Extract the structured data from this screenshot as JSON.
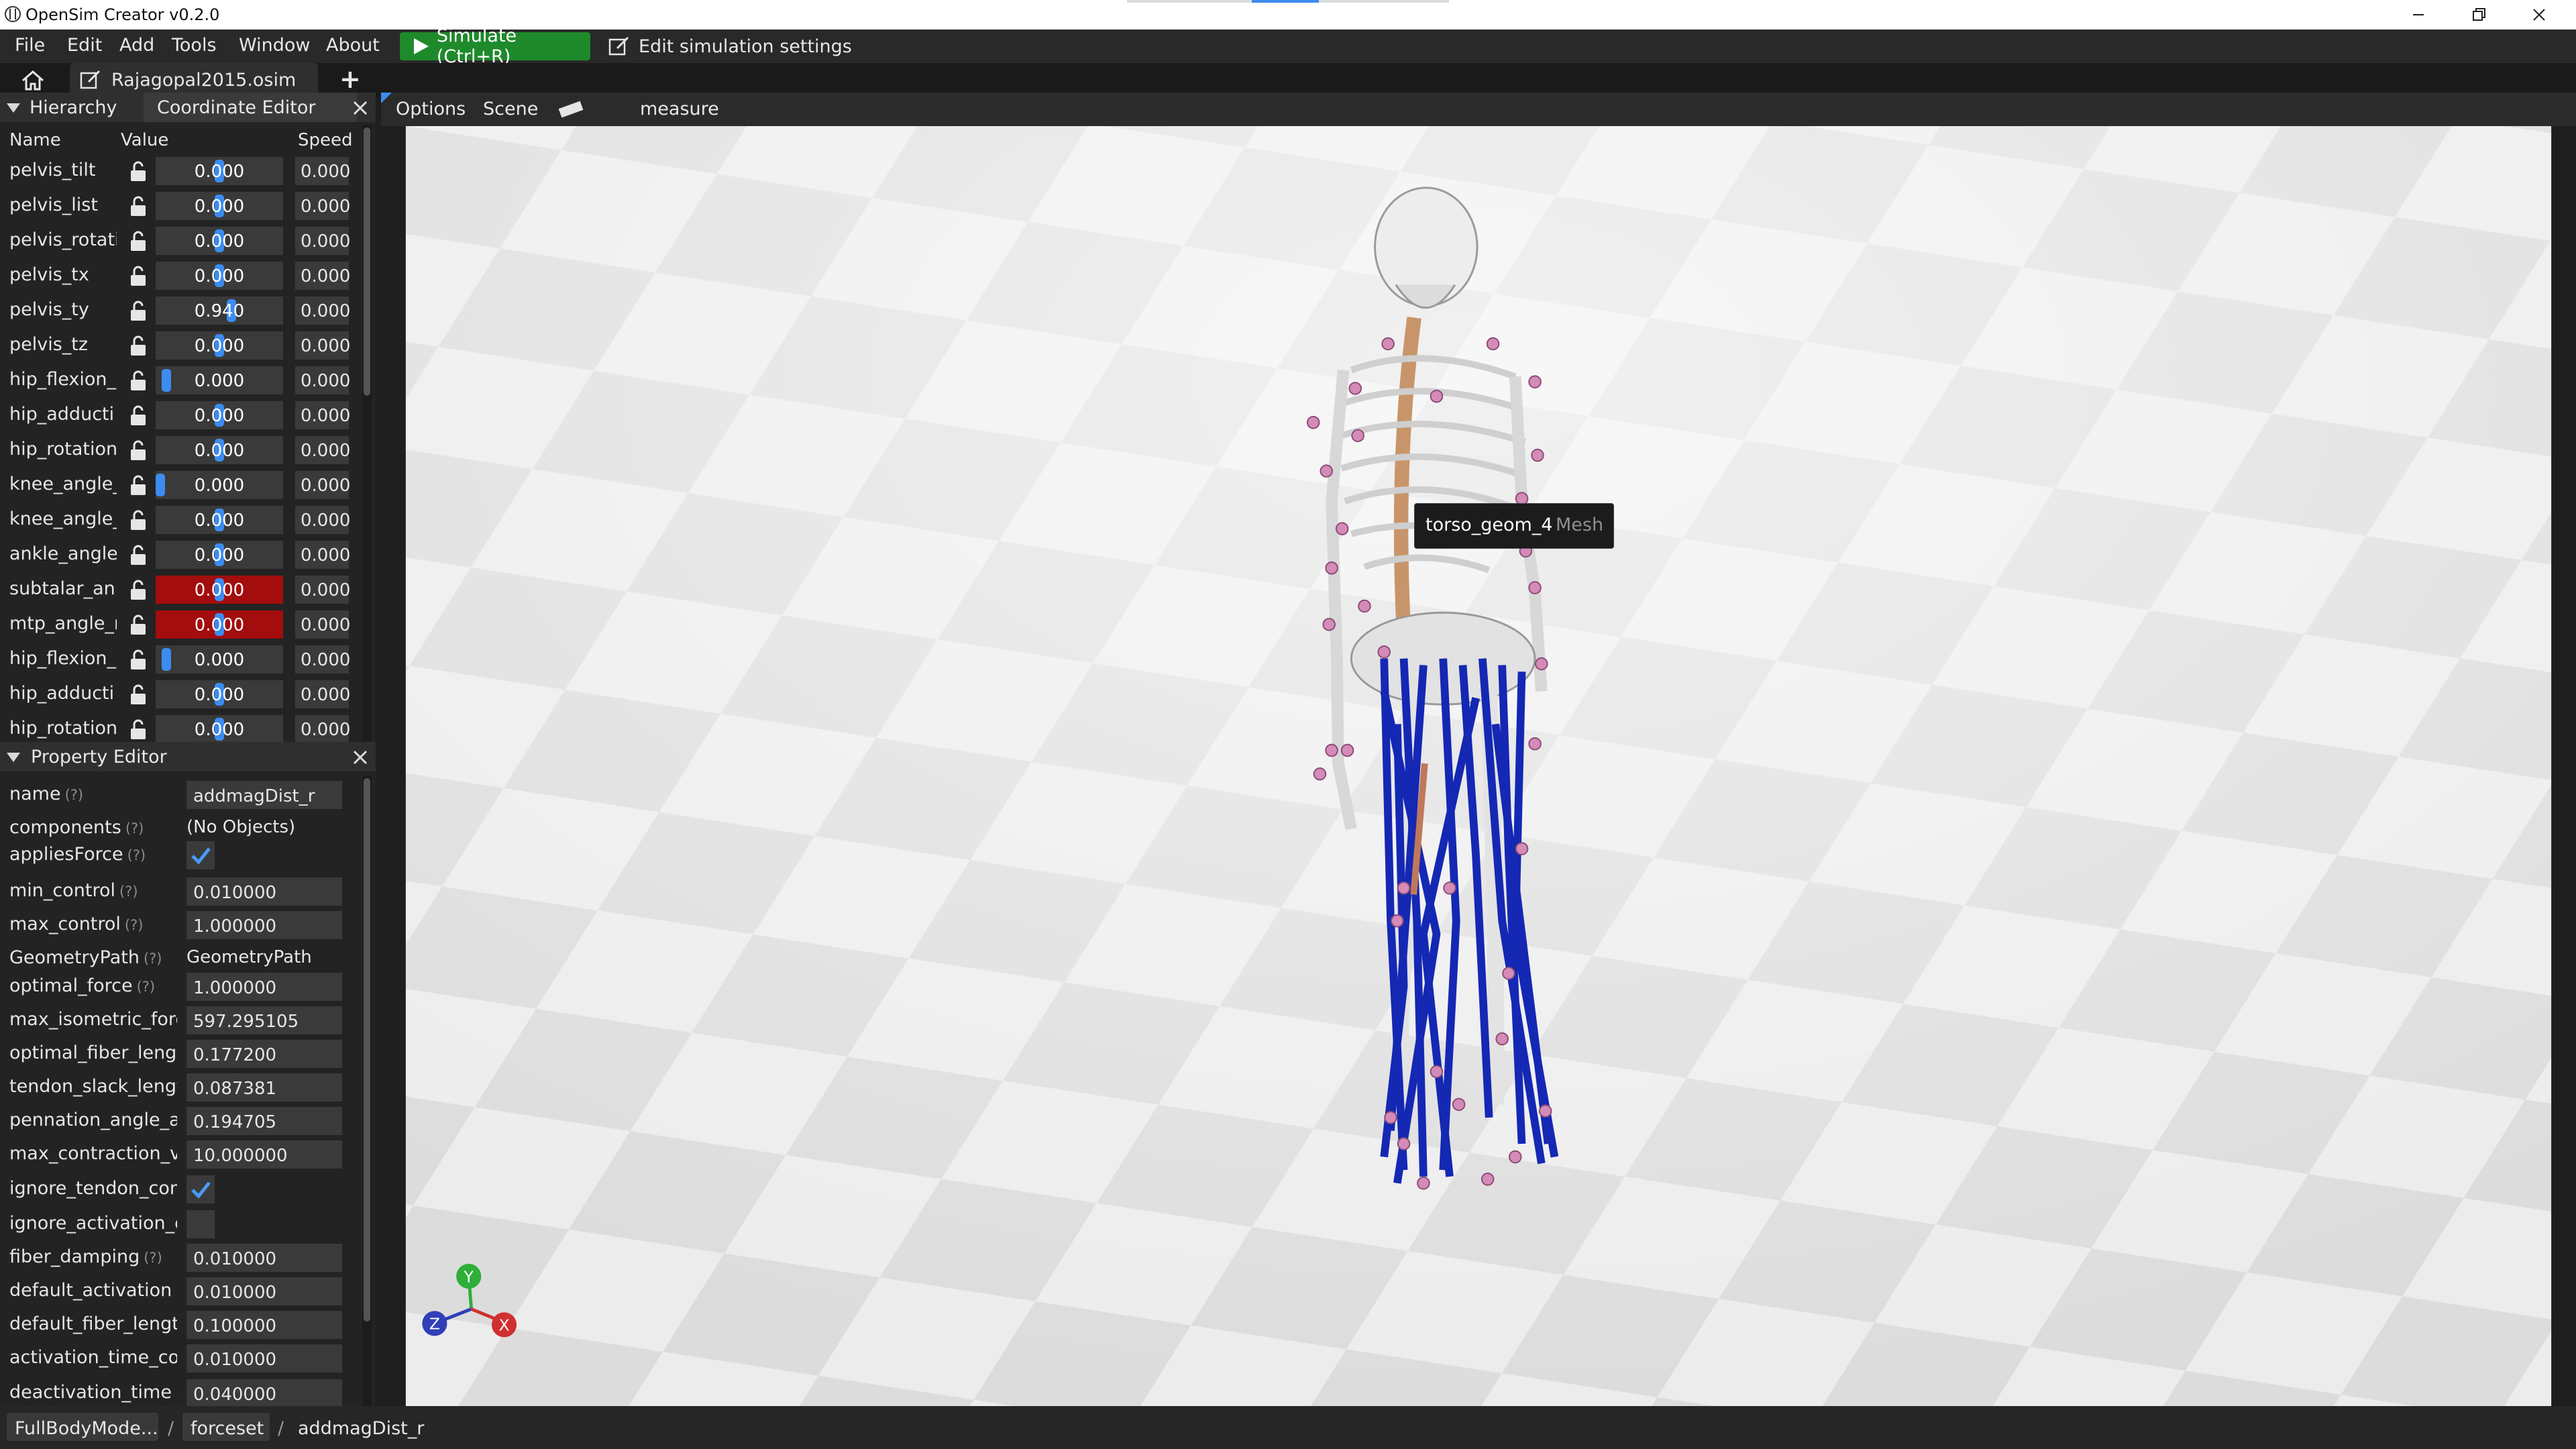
{
  "window": {
    "title": "OpenSim Creator v0.2.0"
  },
  "menu": {
    "items": [
      "File",
      "Edit",
      "Add",
      "Tools",
      "Window",
      "About"
    ],
    "simulate_label": "Simulate (Ctrl+R)",
    "edit_sim_label": "Edit simulation settings"
  },
  "tabs": {
    "file_tab": "Rajagopal2015.osim",
    "add_tab_glyph": "+"
  },
  "coordinate_panel": {
    "tab_hierarchy": "Hierarchy",
    "tab_coordinate_editor": "Coordinate Editor",
    "columns": {
      "name": "Name",
      "value": "Value",
      "speed": "Speed"
    },
    "rows": [
      {
        "name": "pelvis_tilt",
        "value": "0.000",
        "speed": "0.000",
        "locked": false,
        "slider_fraction": 0.5
      },
      {
        "name": "pelvis_list",
        "value": "0.000",
        "speed": "0.000",
        "locked": false,
        "slider_fraction": 0.5
      },
      {
        "name": "pelvis_rotati",
        "value": "0.000",
        "speed": "0.000",
        "locked": false,
        "slider_fraction": 0.5
      },
      {
        "name": "pelvis_tx",
        "value": "0.000",
        "speed": "0.000",
        "locked": false,
        "slider_fraction": 0.5
      },
      {
        "name": "pelvis_ty",
        "value": "0.940",
        "speed": "0.000",
        "locked": false,
        "slider_fraction": 0.6
      },
      {
        "name": "pelvis_tz",
        "value": "0.000",
        "speed": "0.000",
        "locked": false,
        "slider_fraction": 0.5
      },
      {
        "name": "hip_flexion_",
        "value": "0.000",
        "speed": "0.000",
        "locked": false,
        "slider_fraction": 0.05
      },
      {
        "name": "hip_adducti",
        "value": "0.000",
        "speed": "0.000",
        "locked": false,
        "slider_fraction": 0.5
      },
      {
        "name": "hip_rotation",
        "value": "0.000",
        "speed": "0.000",
        "locked": false,
        "slider_fraction": 0.5
      },
      {
        "name": "knee_angle_",
        "value": "0.000",
        "speed": "0.000",
        "locked": false,
        "slider_fraction": 0.0
      },
      {
        "name": "knee_angle_",
        "value": "0.000",
        "speed": "0.000",
        "locked": false,
        "slider_fraction": 0.5
      },
      {
        "name": "ankle_angle",
        "value": "0.000",
        "speed": "0.000",
        "locked": false,
        "slider_fraction": 0.5
      },
      {
        "name": "subtalar_an",
        "value": "0.000",
        "speed": "0.000",
        "locked": true,
        "slider_fraction": 0.5
      },
      {
        "name": "mtp_angle_r",
        "value": "0.000",
        "speed": "0.000",
        "locked": true,
        "slider_fraction": 0.5
      },
      {
        "name": "hip_flexion_",
        "value": "0.000",
        "speed": "0.000",
        "locked": false,
        "slider_fraction": 0.05
      },
      {
        "name": "hip_adducti",
        "value": "0.000",
        "speed": "0.000",
        "locked": false,
        "slider_fraction": 0.5
      },
      {
        "name": "hip_rotation",
        "value": "0.000",
        "speed": "0.000",
        "locked": false,
        "slider_fraction": 0.5
      }
    ]
  },
  "property_editor": {
    "title": "Property Editor",
    "help_glyph": "(?)",
    "rows": [
      {
        "name": "name",
        "kind": "field",
        "value": "addmagDist_r"
      },
      {
        "name": "components",
        "kind": "plain",
        "value": "(No Objects)"
      },
      {
        "name": "appliesForce",
        "kind": "check",
        "value": "checked"
      },
      {
        "name": "min_control",
        "kind": "field",
        "value": "0.010000"
      },
      {
        "name": "max_control",
        "kind": "field",
        "value": "1.000000"
      },
      {
        "name": "GeometryPath",
        "kind": "plain",
        "value": "GeometryPath"
      },
      {
        "name": "optimal_force",
        "kind": "field",
        "value": "1.000000"
      },
      {
        "name": "max_isometric_forc",
        "kind": "field",
        "value": "597.295105"
      },
      {
        "name": "optimal_fiber_lengt",
        "kind": "field",
        "value": "0.177200"
      },
      {
        "name": "tendon_slack_lengt",
        "kind": "field",
        "value": "0.087381"
      },
      {
        "name": "pennation_angle_a",
        "kind": "field",
        "value": "0.194705"
      },
      {
        "name": "max_contraction_v",
        "kind": "field",
        "value": "10.000000"
      },
      {
        "name": "ignore_tendon_com",
        "kind": "check",
        "value": "checked"
      },
      {
        "name": "ignore_activation_c",
        "kind": "check",
        "value": "unchecked"
      },
      {
        "name": "fiber_damping",
        "kind": "field",
        "value": "0.010000"
      },
      {
        "name": "default_activation",
        "kind": "field",
        "value": "0.010000"
      },
      {
        "name": "default_fiber_lengt",
        "kind": "field",
        "value": "0.100000"
      },
      {
        "name": "activation_time_co",
        "kind": "field",
        "value": "0.010000"
      },
      {
        "name": "deactivation_time",
        "kind": "field",
        "value": "0.040000"
      }
    ]
  },
  "viewport": {
    "toolbar": {
      "options": "Options",
      "scene": "Scene",
      "measure": "measure"
    },
    "tooltip": {
      "label": "torso_geom_4",
      "type": "Mesh"
    },
    "axes": {
      "y": "Y",
      "z": "Z",
      "x": "X"
    },
    "colors": {
      "muscle": "#1428b4",
      "selected_muscle": "#c0785a",
      "marker": "#d48bb8",
      "bone": "#e8e8e8",
      "floor_light": "#ececec",
      "floor_dark": "#d6d6d6",
      "axis_x": "#d03030",
      "axis_y": "#2fae3a",
      "axis_z": "#2f3fb8"
    }
  },
  "breadcrumb": {
    "items": [
      "FullBodyMode...",
      "forceset",
      "addmagDist_r"
    ],
    "separator": "/"
  },
  "colors": {
    "accent": "#3c8cf0",
    "simulate_green": "#1f8a2b",
    "locked_red": "#a30d0d"
  }
}
